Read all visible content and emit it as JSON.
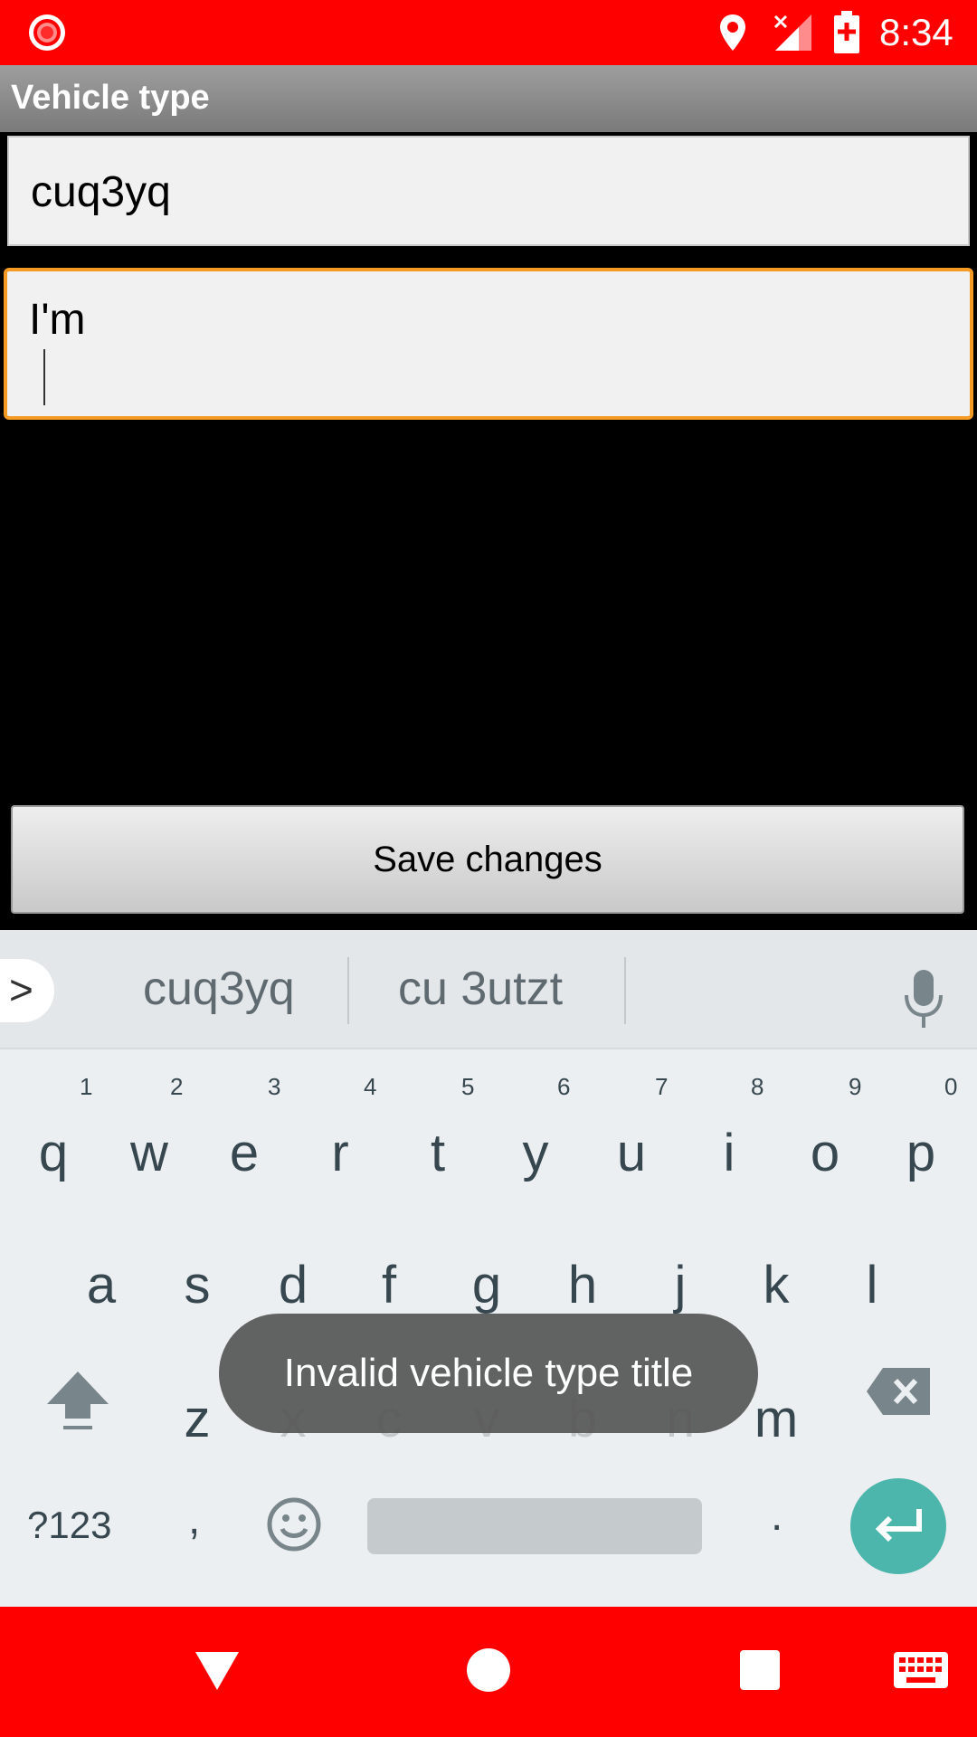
{
  "status_bar": {
    "time": "8:34",
    "icons": [
      "screen-record-icon",
      "location-icon",
      "signal-icon",
      "battery-charging-icon"
    ],
    "background": "#ff0000"
  },
  "app_bar": {
    "title": "Vehicle type"
  },
  "form": {
    "title_field_value": "cuq3yq",
    "description_field_value": "I'm",
    "focused_border_color": "#f59a23"
  },
  "save_button": {
    "label": "Save changes"
  },
  "keyboard": {
    "suggestions": [
      "cuq3yq",
      "cu 3utzt"
    ],
    "row1": [
      {
        "key": "q",
        "hint": "1"
      },
      {
        "key": "w",
        "hint": "2"
      },
      {
        "key": "e",
        "hint": "3"
      },
      {
        "key": "r",
        "hint": "4"
      },
      {
        "key": "t",
        "hint": "5"
      },
      {
        "key": "y",
        "hint": "6"
      },
      {
        "key": "u",
        "hint": "7"
      },
      {
        "key": "i",
        "hint": "8"
      },
      {
        "key": "o",
        "hint": "9"
      },
      {
        "key": "p",
        "hint": "0"
      }
    ],
    "row2": [
      "a",
      "s",
      "d",
      "f",
      "g",
      "h",
      "j",
      "k",
      "l"
    ],
    "row3": [
      "z",
      "x",
      "c",
      "v",
      "b",
      "n",
      "m"
    ],
    "symbols_label": "?123",
    "comma": ",",
    "period": ".",
    "enter_color": "#4db6ac"
  },
  "toast": {
    "message": "Invalid vehicle type title"
  },
  "nav_bar": {
    "background": "#ff0000",
    "icons": [
      "back-icon",
      "home-icon",
      "recents-icon",
      "keyboard-icon"
    ]
  }
}
